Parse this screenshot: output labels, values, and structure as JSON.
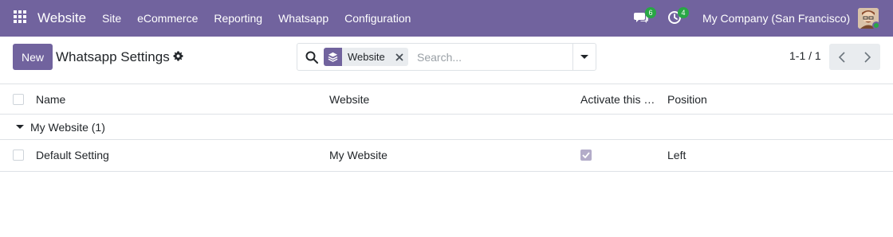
{
  "navbar": {
    "brand": "Website",
    "menu": [
      "Site",
      "eCommerce",
      "Reporting",
      "Whatsapp",
      "Configuration"
    ],
    "messages_count": "6",
    "activities_count": "4",
    "company": "My Company (San Francisco)",
    "icons": {
      "apps": "apps-grid-icon",
      "messages": "chat-icon",
      "activities": "clock-icon",
      "user": "avatar"
    }
  },
  "control_panel": {
    "new_label": "New",
    "title": "Whatsapp Settings",
    "search": {
      "facet_label": "Website",
      "placeholder": "Search..."
    },
    "pager": "1-1 / 1"
  },
  "list": {
    "columns": [
      "Name",
      "Website",
      "Activate this s…",
      "Position"
    ],
    "groups": [
      {
        "label": "My Website (1)",
        "rows": [
          {
            "name": "Default Setting",
            "website": "My Website",
            "activate": true,
            "position": "Left"
          }
        ]
      }
    ]
  },
  "colors": {
    "brand": "#71639e",
    "badge": "#28a745"
  }
}
